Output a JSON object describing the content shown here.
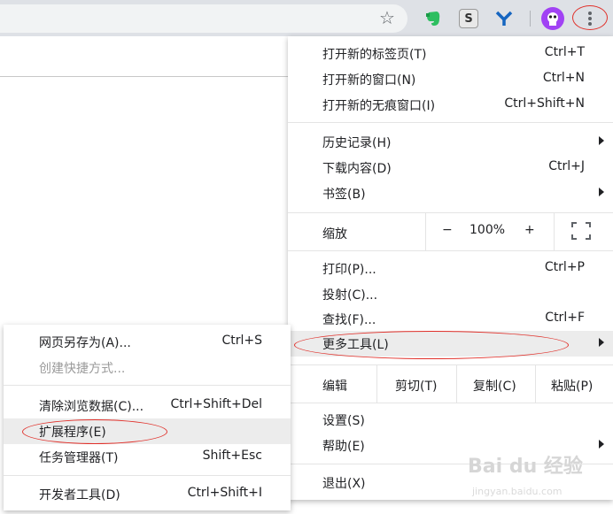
{
  "toolbar": {
    "icons": [
      "star-icon",
      "evernote-icon",
      "s-extension-icon",
      "y-extension-icon",
      "profile-avatar-icon",
      "more-menu-icon"
    ],
    "s_ext_letter": "S",
    "y_ext_letter": "Y"
  },
  "main_menu": {
    "new_tab": {
      "label": "打开新的标签页(T)",
      "shortcut": "Ctrl+T"
    },
    "new_window": {
      "label": "打开新的窗口(N)",
      "shortcut": "Ctrl+N"
    },
    "incognito": {
      "label": "打开新的无痕窗口(I)",
      "shortcut": "Ctrl+Shift+N"
    },
    "history": {
      "label": "历史记录(H)"
    },
    "downloads": {
      "label": "下载内容(D)",
      "shortcut": "Ctrl+J"
    },
    "bookmarks": {
      "label": "书签(B)"
    },
    "zoom": {
      "label": "缩放",
      "minus": "−",
      "value": "100%",
      "plus": "+"
    },
    "print": {
      "label": "打印(P)...",
      "shortcut": "Ctrl+P"
    },
    "cast": {
      "label": "投射(C)..."
    },
    "find": {
      "label": "查找(F)...",
      "shortcut": "Ctrl+F"
    },
    "more_tools": {
      "label": "更多工具(L)"
    },
    "edit": {
      "label": "编辑",
      "cut": "剪切(T)",
      "copy": "复制(C)",
      "paste": "粘贴(P)"
    },
    "settings": {
      "label": "设置(S)"
    },
    "help": {
      "label": "帮助(E)"
    },
    "exit": {
      "label": "退出(X)"
    }
  },
  "sub_menu": {
    "save_page": {
      "label": "网页另存为(A)...",
      "shortcut": "Ctrl+S"
    },
    "create_shortcut": {
      "label": "创建快捷方式..."
    },
    "clear_data": {
      "label": "清除浏览数据(C)...",
      "shortcut": "Ctrl+Shift+Del"
    },
    "extensions": {
      "label": "扩展程序(E)"
    },
    "task_manager": {
      "label": "任务管理器(T)",
      "shortcut": "Shift+Esc"
    },
    "dev_tools": {
      "label": "开发者工具(D)",
      "shortcut": "Ctrl+Shift+I"
    }
  },
  "watermark": {
    "text": "Bai du 经验",
    "sub": "jingyan.baidu.com"
  },
  "colors": {
    "highlight_ring": "#e0302a",
    "hover": "#ececec",
    "toolbar": "#dee1e6"
  }
}
